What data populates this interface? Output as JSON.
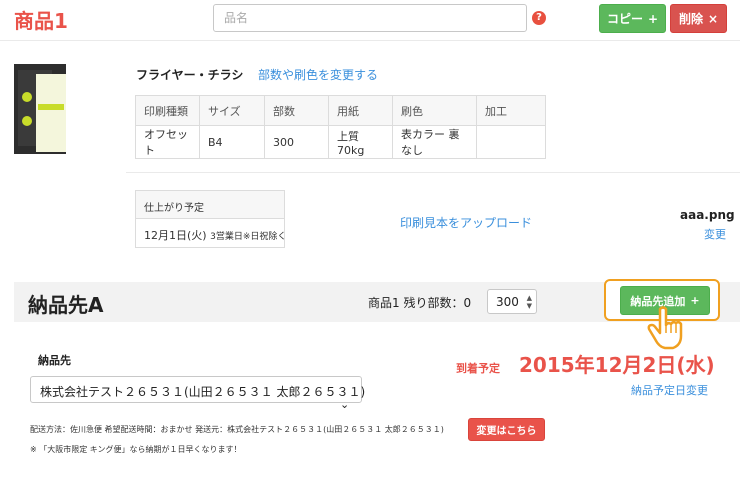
{
  "header": {
    "title": "商品1",
    "name_placeholder": "品名",
    "help_symbol": "?",
    "copy_label": "コピー",
    "copy_icon": "+",
    "delete_label": "削除",
    "delete_icon": "×"
  },
  "product": {
    "name": "フライヤー・チラシ",
    "change_link": "部数や刷色を変更する",
    "table": {
      "headers": [
        "印刷種類",
        "サイズ",
        "部数",
        "用紙",
        "刷色",
        "加工"
      ],
      "row": [
        "オフセット",
        "B4",
        "300",
        "上質 70kg",
        "表カラー 裏なし",
        ""
      ]
    },
    "finish": {
      "label": "仕上がり予定",
      "date": "12月1日(火)",
      "note": "3営業日※日祝除く"
    },
    "upload_link": "印刷見本をアップロード",
    "file_name": "aaa.png",
    "file_change": "変更"
  },
  "delivery": {
    "title": "納品先A",
    "remaining_label": "商品1 残り部数：0",
    "quantity": "300",
    "add_label": "納品先追加",
    "add_icon": "+",
    "destination_label": "納品先",
    "destination_value": "株式会社テスト２６５３１(山田２６５３１ 太郎２６５３１)",
    "arrival_label": "到着予定",
    "arrival_date": "2015年12月2日(水)",
    "change_date_link": "納品予定日変更",
    "shipping_info": "配送方法：佐川急便 希望配送時間：おまかせ 発送元：株式会社テスト２６５３１(山田２６５３１ 太郎２６５３１)",
    "change_button": "変更はこちら",
    "note": "※ 「大阪市限定 キング便」なら納期が１日早くなります！"
  },
  "colors": {
    "accent_red": "#e9534a",
    "button_green": "#5cb85c",
    "link_blue": "#3a8fdc",
    "highlight_orange": "#f0a020"
  }
}
